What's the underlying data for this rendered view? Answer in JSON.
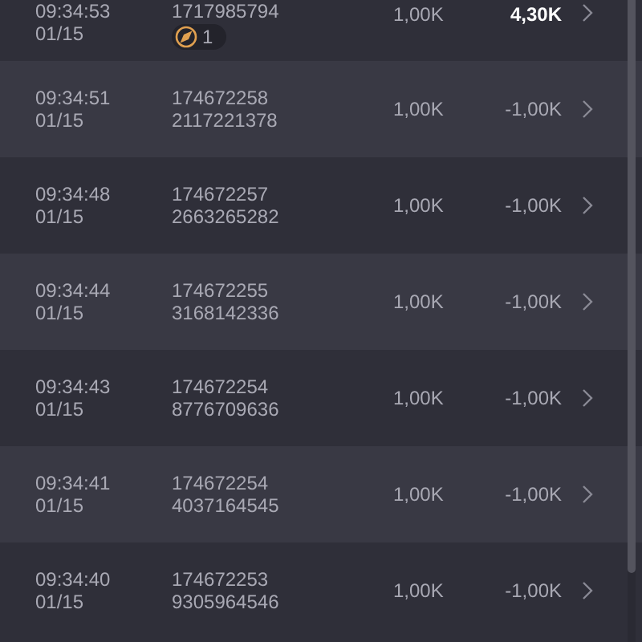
{
  "rows": [
    {
      "time": "09:34:53",
      "date": "01/15",
      "ids": [
        "1717985794"
      ],
      "badge": {
        "count": "1"
      },
      "amount": "1,00K",
      "result": "4,30K",
      "emphasized": true
    },
    {
      "time": "09:34:51",
      "date": "01/15",
      "ids": [
        "174672258",
        "2117221378"
      ],
      "amount": "1,00K",
      "result": "-1,00K",
      "emphasized": false
    },
    {
      "time": "09:34:48",
      "date": "01/15",
      "ids": [
        "174672257",
        "2663265282"
      ],
      "amount": "1,00K",
      "result": "-1,00K",
      "emphasized": false
    },
    {
      "time": "09:34:44",
      "date": "01/15",
      "ids": [
        "174672255",
        "3168142336"
      ],
      "amount": "1,00K",
      "result": "-1,00K",
      "emphasized": false
    },
    {
      "time": "09:34:43",
      "date": "01/15",
      "ids": [
        "174672254",
        "8776709636"
      ],
      "amount": "1,00K",
      "result": "-1,00K",
      "emphasized": false
    },
    {
      "time": "09:34:41",
      "date": "01/15",
      "ids": [
        "174672254",
        "4037164545"
      ],
      "amount": "1,00K",
      "result": "-1,00K",
      "emphasized": false
    },
    {
      "time": "09:34:40",
      "date": "01/15",
      "ids": [
        "174672253",
        "9305964546"
      ],
      "amount": "1,00K",
      "result": "-1,00K",
      "emphasized": false
    }
  ]
}
